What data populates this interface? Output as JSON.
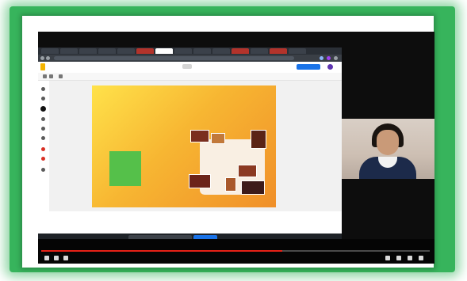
{
  "browser": {
    "tabs": [
      "",
      "",
      "",
      "",
      "",
      "",
      "",
      "",
      "",
      "",
      "",
      "",
      "",
      ""
    ],
    "url": ""
  },
  "slides_app": {
    "doc_title": "",
    "present_label": "",
    "toolbar_items": [
      "",
      ""
    ]
  },
  "slide": {
    "title": "",
    "proposito_label": "",
    "proposito_text": "",
    "handwritten_left": "",
    "green_box_text": "",
    "handwritten_center": "",
    "elements_label": ""
  },
  "zoom": {
    "share_text": "",
    "share_pill_text": "",
    "stop_share_label": ""
  },
  "video": {
    "progress": 0.62
  },
  "participant": {
    "name": ""
  },
  "colors": {
    "frame_green": "#37b45c",
    "slide_yellow": "#ffe24a",
    "slide_orange": "#f08f29",
    "slide_text_red": "#c8321e",
    "present_blue": "#1a73e8",
    "video_red": "#e62117"
  }
}
